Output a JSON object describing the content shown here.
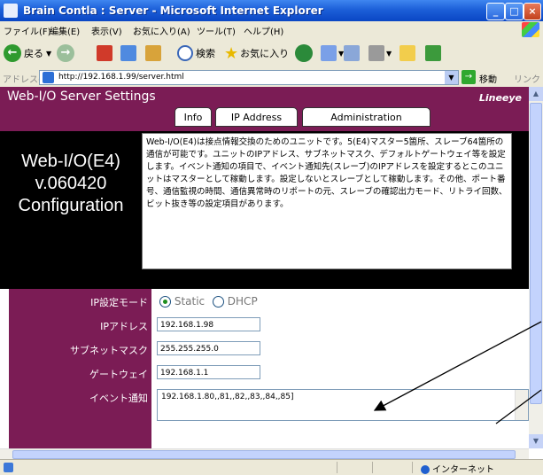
{
  "window": {
    "title": "Brain Contla : Server - Microsoft Internet Explorer",
    "minimize_glyph": "_",
    "maximize_glyph": "□",
    "close_glyph": "×"
  },
  "menu": [
    "ファイル(F)",
    "編集(E)",
    "表示(V)",
    "お気に入り(A)",
    "ツール(T)",
    "ヘルプ(H)"
  ],
  "toolbar": {
    "back": "戻る",
    "search": "検索",
    "favorites": "お気に入り"
  },
  "address": {
    "label": "アドレス(D)",
    "url": "http://192.168.1.99/server.html",
    "go": "移動",
    "links": "リンク"
  },
  "page": {
    "title": "Web-I/O Server Settings",
    "brand": "Lineeye",
    "tabs": [
      "Info",
      "IP Address",
      "Administration"
    ],
    "config_lines": [
      "Web-I/O(E4)",
      "v.060420",
      "Configuration"
    ],
    "description": "Web-I/O(E4)は接点情報交換のためのユニットです。5(E4)マスター5箇所、スレーブ64箇所の通信が可能です。ユニットのIPアドレス、サブネットマスク、デフォルトゲートウェイ等を設定します。イベント通知の項目で、イベント通知先(スレーブ)のIPアドレスを設定するとこのユニットはマスターとして稼動します。設定しないとスレーブとして稼動します。その他、ポート番号、通信監視の時間、通信異常時のリポートの元、スレーブの確認出力モード、リトライ回数、ビット抜き等の設定項目があります。",
    "form": {
      "ip_mode_label": "IP設定モード",
      "static_label": "Static",
      "dhcp_label": "DHCP",
      "ip_label": "IPアドレス",
      "ip_value": "192.168.1.98",
      "subnet_label": "サブネットマスク",
      "subnet_value": "255.255.255.0",
      "gateway_label": "ゲートウェイ",
      "gateway_value": "192.168.1.1",
      "event_label": "イベント通知",
      "event_value": "192.168.1.80,,81,,82,,83,,84,,85]"
    }
  },
  "status": {
    "zone": "インターネット"
  },
  "colors": {
    "header": "#7b1c55",
    "panel": "#000000",
    "titlebar": "#1c5fd8",
    "chrome": "#ece9d8"
  }
}
